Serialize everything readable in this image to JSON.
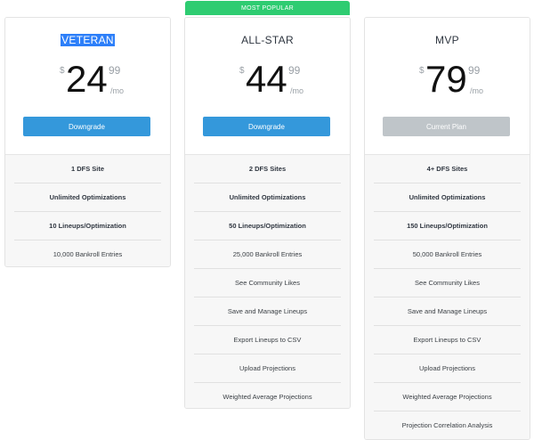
{
  "badge": {
    "label": "MOST POPULAR",
    "color": "#2ecc71"
  },
  "plans": [
    {
      "name": "VETERAN",
      "currency": "$",
      "amount": "24",
      "cents": "99",
      "period": "/mo",
      "button_label": "Downgrade",
      "button_style": "blue",
      "features": [
        "1 DFS Site",
        "Unlimited Optimizations",
        "10 Lineups/Optimization",
        "10,000 Bankroll Entries"
      ]
    },
    {
      "name": "ALL-STAR",
      "currency": "$",
      "amount": "44",
      "cents": "99",
      "period": "/mo",
      "button_label": "Downgrade",
      "button_style": "blue",
      "features": [
        "2 DFS Sites",
        "Unlimited Optimizations",
        "50 Lineups/Optimization",
        "25,000 Bankroll Entries",
        "See Community Likes",
        "Save and Manage Lineups",
        "Export Lineups to CSV",
        "Upload Projections",
        "Weighted Average Projections"
      ]
    },
    {
      "name": "MVP",
      "currency": "$",
      "amount": "79",
      "cents": "99",
      "period": "/mo",
      "button_label": "Current Plan",
      "button_style": "gray",
      "features": [
        "4+ DFS Sites",
        "Unlimited Optimizations",
        "150 Lineups/Optimization",
        "50,000 Bankroll Entries",
        "See Community Likes",
        "Save and Manage Lineups",
        "Export Lineups to CSV",
        "Upload Projections",
        "Weighted Average Projections",
        "Projection Correlation Analysis"
      ]
    }
  ],
  "colors": {
    "button_blue": "#3498db",
    "button_gray": "#bfc5c9",
    "selection": "#2d7ff9"
  }
}
